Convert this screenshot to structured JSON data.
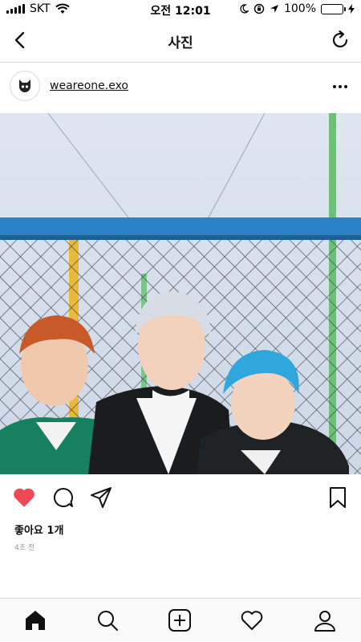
{
  "status_bar": {
    "carrier": "SKT",
    "time": "오전 12:01",
    "battery": "100%",
    "battery_level": 1.0,
    "battery_color": "#4cd964"
  },
  "nav": {
    "title": "사진",
    "back_icon": "chevron-left-icon",
    "refresh_icon": "refresh-icon"
  },
  "post": {
    "username": "weareone.exo",
    "avatar_icon": "exo-logo-icon",
    "more_icon": "more-dots-icon",
    "likes": "좋아요 1개",
    "timestamp": "4초 전",
    "liked": true,
    "like_color": "#ed4956"
  },
  "actions": [
    "heart-icon",
    "comment-icon",
    "share-icon",
    "bookmark-icon"
  ],
  "tab_bar": [
    "home-icon",
    "search-icon",
    "add-post-icon",
    "activity-heart-icon",
    "profile-icon"
  ]
}
